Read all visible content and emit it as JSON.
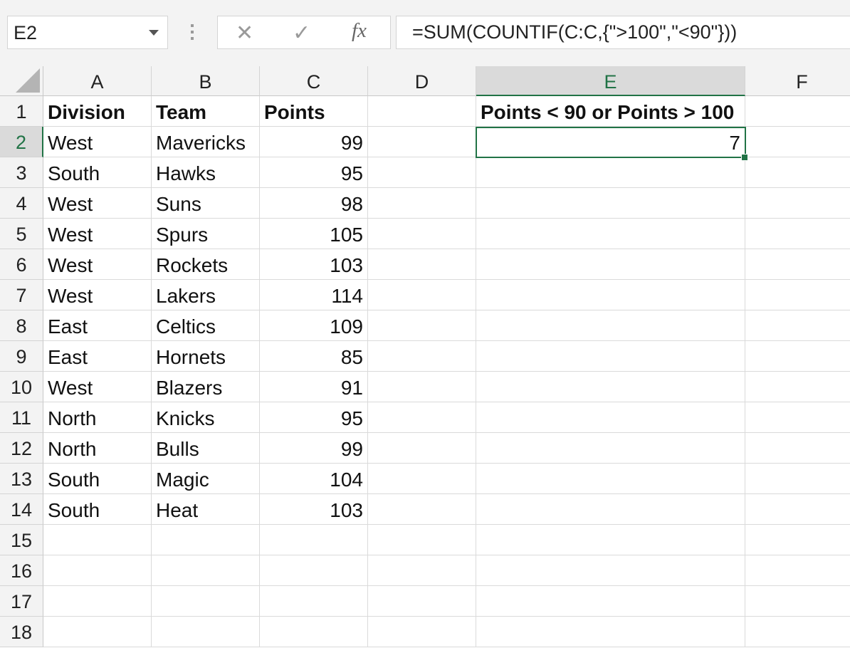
{
  "name_box": {
    "value": "E2"
  },
  "formula_bar": {
    "cancel_glyph": "✕",
    "enter_glyph": "✓",
    "fx_label": "fx",
    "formula": "=SUM(COUNTIF(C:C,{\">100\",\"<90\"}))"
  },
  "columns": [
    "A",
    "B",
    "C",
    "D",
    "E",
    "F"
  ],
  "selected_column": "E",
  "row_numbers": [
    "1",
    "2",
    "3",
    "4",
    "5",
    "6",
    "7",
    "8",
    "9",
    "10",
    "11",
    "12",
    "13",
    "14",
    "15",
    "16",
    "17",
    "18"
  ],
  "selected_row": "2",
  "sheet": {
    "headers": {
      "division": "Division",
      "team": "Team",
      "points": "Points"
    },
    "rows": [
      {
        "division": "West",
        "team": "Mavericks",
        "points": "99"
      },
      {
        "division": "South",
        "team": "Hawks",
        "points": "95"
      },
      {
        "division": "West",
        "team": "Suns",
        "points": "98"
      },
      {
        "division": "West",
        "team": "Spurs",
        "points": "105"
      },
      {
        "division": "West",
        "team": "Rockets",
        "points": "103"
      },
      {
        "division": "West",
        "team": "Lakers",
        "points": "114"
      },
      {
        "division": "East",
        "team": "Celtics",
        "points": "109"
      },
      {
        "division": "East",
        "team": "Hornets",
        "points": "85"
      },
      {
        "division": "West",
        "team": "Blazers",
        "points": "91"
      },
      {
        "division": "North",
        "team": "Knicks",
        "points": "95"
      },
      {
        "division": "North",
        "team": "Bulls",
        "points": "99"
      },
      {
        "division": "South",
        "team": "Magic",
        "points": "104"
      },
      {
        "division": "South",
        "team": "Heat",
        "points": "103"
      }
    ],
    "e1": "Points < 90 or Points > 100",
    "e2": "7"
  },
  "colors": {
    "accent": "#217346",
    "header_bg": "#f3f3f3",
    "selected_header_bg": "#dadada"
  }
}
